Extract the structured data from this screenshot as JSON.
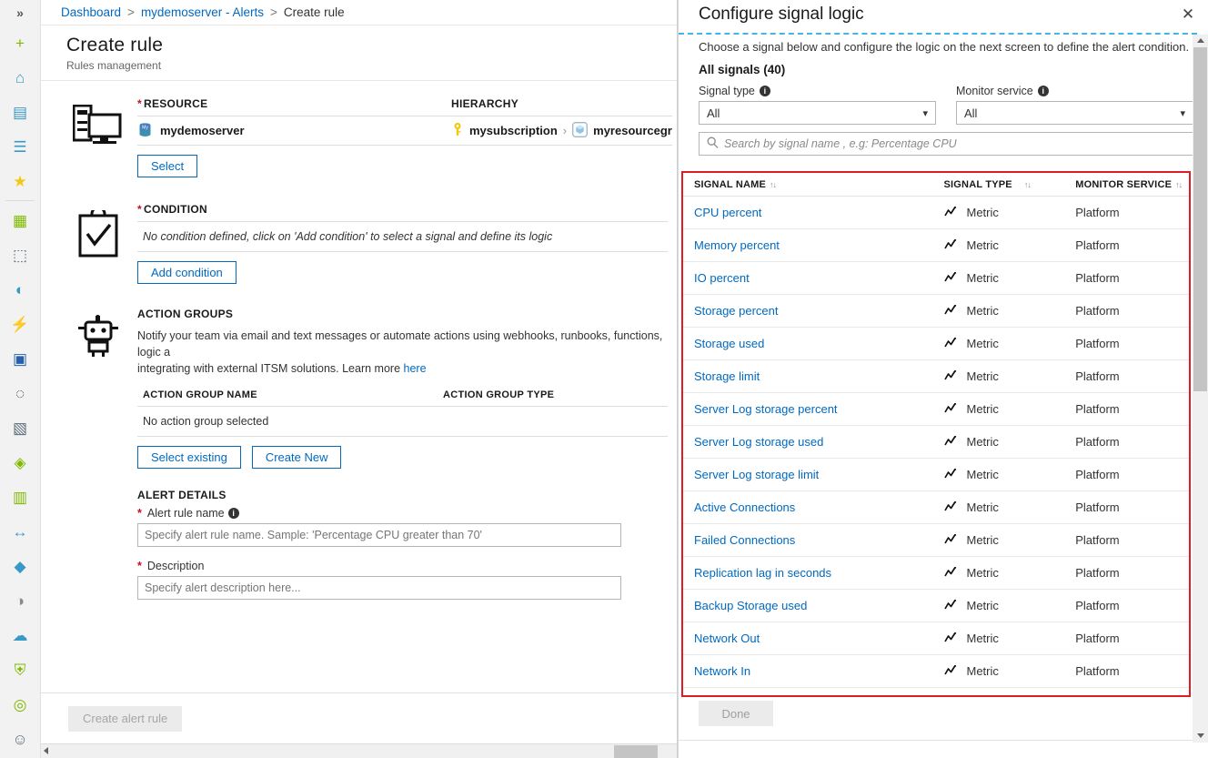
{
  "rail": {
    "collapse_label": "»",
    "items": [
      {
        "name": "create-resource-icon",
        "glyph": "+",
        "color": "#7fba00"
      },
      {
        "name": "home-icon",
        "glyph": "⌂",
        "color": "#3999c6"
      },
      {
        "name": "dashboard-icon",
        "glyph": "▤",
        "color": "#3999c6"
      },
      {
        "name": "all-services-icon",
        "glyph": "☰",
        "color": "#3999c6"
      },
      {
        "name": "favorites-star-icon",
        "glyph": "★",
        "color": "#f2c811"
      },
      {
        "name": "all-resources-icon",
        "glyph": "▦",
        "color": "#7fba00"
      },
      {
        "name": "resource-groups-icon",
        "glyph": "⬚",
        "color": "#5b6b78"
      },
      {
        "name": "app-services-icon",
        "glyph": "◐",
        "color": "#3999c6"
      },
      {
        "name": "function-apps-icon",
        "glyph": "⚡",
        "color": "#f2a01d"
      },
      {
        "name": "sql-databases-icon",
        "glyph": "▣",
        "color": "#2560a8"
      },
      {
        "name": "azure-cosmos-db-icon",
        "glyph": "◌",
        "color": "#3b4a5a"
      },
      {
        "name": "virtual-machines-icon",
        "glyph": "▧",
        "color": "#5b6b78"
      },
      {
        "name": "load-balancers-icon",
        "glyph": "◈",
        "color": "#7fba00"
      },
      {
        "name": "storage-accounts-icon",
        "glyph": "▥",
        "color": "#7fba00"
      },
      {
        "name": "virtual-networks-icon",
        "glyph": "↔",
        "color": "#3999c6"
      },
      {
        "name": "azure-active-directory-icon",
        "glyph": "◆",
        "color": "#3999c6"
      },
      {
        "name": "monitor-icon",
        "glyph": "◑",
        "color": "#8a8a8a"
      },
      {
        "name": "advisor-icon",
        "glyph": "☁",
        "color": "#3999c6"
      },
      {
        "name": "security-center-icon",
        "glyph": "⛨",
        "color": "#7fba00"
      },
      {
        "name": "cost-management-icon",
        "glyph": "◎",
        "color": "#7fba00"
      },
      {
        "name": "help-support-icon",
        "glyph": "☺",
        "color": "#5b6b78"
      }
    ]
  },
  "breadcrumb": {
    "items": [
      "Dashboard",
      "mydemoserver - Alerts",
      "Create rule"
    ],
    "separator": ">"
  },
  "blade": {
    "title": "Create rule",
    "subtitle": "Rules management",
    "resource": {
      "icon": "server-monitor-icon",
      "label": "RESOURCE",
      "required": "*",
      "hierarchy_label": "HIERARCHY",
      "resource_name": "mydemoserver",
      "resource_icon": "mysql-database-icon",
      "subscription_icon": "key-icon",
      "subscription_name": "mysubscription",
      "hierarchy_separator": "›",
      "resource_group_icon": "resource-group-icon",
      "resource_group_name": "myresourcegr",
      "select_button": "Select"
    },
    "condition": {
      "icon": "clipboard-check-icon",
      "label": "CONDITION",
      "required": "*",
      "empty_text": "No condition defined, click on 'Add condition' to select a signal and define its logic",
      "add_button": "Add condition"
    },
    "action_groups": {
      "icon": "robot-icon",
      "label": "ACTION GROUPS",
      "description_1": "Notify your team via email and text messages or automate actions using webhooks, runbooks, functions, logic a",
      "description_2": "integrating with external ITSM solutions. Learn more ",
      "learn_more_link": "here",
      "col_name": "ACTION GROUP NAME",
      "col_type": "ACTION GROUP TYPE",
      "empty_text": "No action group selected",
      "select_existing_button": "Select existing",
      "create_new_button": "Create New"
    },
    "alert_details": {
      "label": "ALERT DETAILS",
      "rule_name_label": "Alert rule name",
      "rule_name_required": "*",
      "rule_name_placeholder": "Specify alert rule name. Sample: 'Percentage CPU greater than 70'",
      "rule_name_value": "",
      "description_label": "Description",
      "description_required": "*",
      "description_placeholder": "Specify alert description here...",
      "description_value": ""
    },
    "footer": {
      "create_button": "Create alert rule"
    }
  },
  "panel": {
    "title": "Configure signal logic",
    "close_icon": "close-icon",
    "intro": "Choose a signal below and configure the logic on the next screen to define the alert condition.",
    "all_signals": "All signals (40)",
    "signal_type": {
      "label": "Signal type",
      "info_icon": "info-icon",
      "value": "All"
    },
    "monitor_service": {
      "label": "Monitor service",
      "info_icon": "info-icon",
      "value": "All"
    },
    "search": {
      "icon": "search-icon",
      "placeholder": "Search by signal name , e.g: Percentage CPU",
      "value": ""
    },
    "table": {
      "columns": [
        "SIGNAL NAME",
        "SIGNAL TYPE",
        "MONITOR SERVICE"
      ],
      "sort_icon": "sort-arrows-icon",
      "metric_icon": "metric-chart-icon",
      "rows": [
        {
          "name": "CPU percent",
          "type": "Metric",
          "service": "Platform"
        },
        {
          "name": "Memory percent",
          "type": "Metric",
          "service": "Platform"
        },
        {
          "name": "IO percent",
          "type": "Metric",
          "service": "Platform"
        },
        {
          "name": "Storage percent",
          "type": "Metric",
          "service": "Platform"
        },
        {
          "name": "Storage used",
          "type": "Metric",
          "service": "Platform"
        },
        {
          "name": "Storage limit",
          "type": "Metric",
          "service": "Platform"
        },
        {
          "name": "Server Log storage percent",
          "type": "Metric",
          "service": "Platform"
        },
        {
          "name": "Server Log storage used",
          "type": "Metric",
          "service": "Platform"
        },
        {
          "name": "Server Log storage limit",
          "type": "Metric",
          "service": "Platform"
        },
        {
          "name": "Active Connections",
          "type": "Metric",
          "service": "Platform"
        },
        {
          "name": "Failed Connections",
          "type": "Metric",
          "service": "Platform"
        },
        {
          "name": "Replication lag in seconds",
          "type": "Metric",
          "service": "Platform"
        },
        {
          "name": "Backup Storage used",
          "type": "Metric",
          "service": "Platform"
        },
        {
          "name": "Network Out",
          "type": "Metric",
          "service": "Platform"
        },
        {
          "name": "Network In",
          "type": "Metric",
          "service": "Platform"
        }
      ]
    },
    "done_button": "Done",
    "highlight_color": "#e01b24"
  }
}
